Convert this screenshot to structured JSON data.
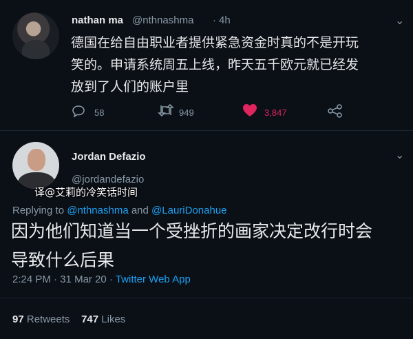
{
  "tweet1": {
    "author_name": "nathan ma",
    "handle": "@nthnashma",
    "separator": "·",
    "time": "4h",
    "text_lines": [
      "德国在给自由职业者提供紧急资金时真的不是开玩",
      "笑的。申请系统周五上线，昨天五千欧元就已经发",
      "放到了人们的账户里"
    ],
    "replies": "58",
    "retweets": "949",
    "likes": "3,847",
    "icons": {
      "reply": "reply-icon",
      "retweet": "retweet-icon",
      "like": "heart-icon",
      "share": "share-icon",
      "menu": "chevron-down-icon"
    },
    "colors": {
      "like": "#e0245e"
    }
  },
  "tweet2": {
    "author_name": "Jordan Defazio",
    "handle": "@jordandefazio",
    "watermark": "译@艾莉的冷笑话时间",
    "replying_prefix": "Replying to",
    "mention1": "@nthnashma",
    "and": "and",
    "mention2": "@LauriDonahue",
    "text_lines": [
      "因为他们知道当一个受挫折的画家决定改行时会",
      "导致什么后果"
    ],
    "time": "2:24 PM",
    "date": "31 Mar 20",
    "app": "Twitter Web App",
    "retweets_count": "97",
    "retweets_label": "Retweets",
    "likes_count": "747",
    "likes_label": "Likes",
    "colors": {
      "link": "#1da1f2",
      "background": "#0b0f16"
    }
  }
}
